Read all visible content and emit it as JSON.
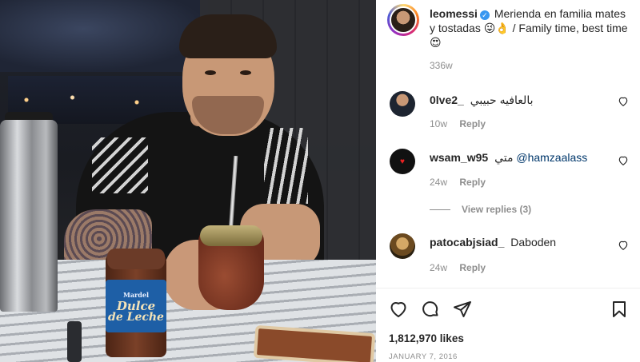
{
  "photo": {
    "jar_brand": "Mardel",
    "jar_label_line1": "Dulce",
    "jar_label_line2": "de Leche"
  },
  "post": {
    "author": "leomessi",
    "caption": "Merienda en familia mates y tostadas 😜👌 / Family time, best time😍",
    "age": "336w",
    "likes": "1,812,970 likes",
    "date": "JANUARY 7, 2016"
  },
  "comments": [
    {
      "user": "0lve2_",
      "text": "بالعافيه حبيبي",
      "age": "10w",
      "reply_label": "Reply"
    },
    {
      "user": "wsam_w95",
      "text_prefix": "متي",
      "mention": "@hamzaalass",
      "age": "24w",
      "reply_label": "Reply",
      "view_replies": "View replies (3)"
    },
    {
      "user": "patocabjsiad_",
      "text": "Daboden",
      "age": "24w",
      "reply_label": "Reply"
    }
  ],
  "icons": [
    "verified-badge-icon",
    "heart-icon",
    "comment-icon",
    "share-icon",
    "bookmark-icon"
  ]
}
